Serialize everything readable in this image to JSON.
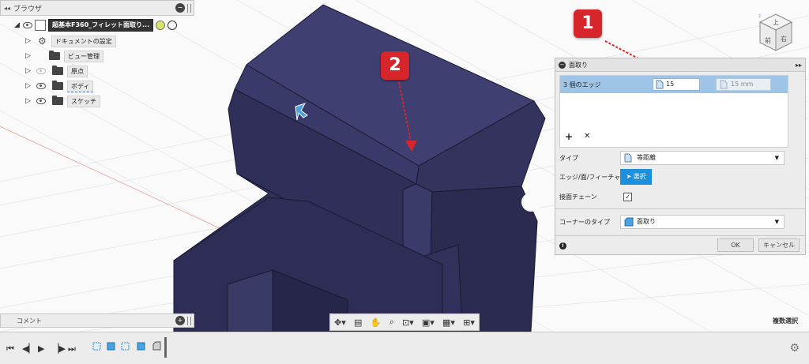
{
  "browser": {
    "title": "ブラウザ",
    "root_label": "超基本F360_フィレット面取り...",
    "items": [
      {
        "label": "ドキュメントの設定"
      },
      {
        "label": "ビュー管理"
      },
      {
        "label": "原点"
      },
      {
        "label": "ボディ"
      },
      {
        "label": "スケッチ"
      }
    ]
  },
  "comment_bar": {
    "label": "コメント"
  },
  "callouts": [
    "1",
    "2"
  ],
  "chamfer_dialog": {
    "title": "面取り",
    "selection_label": "3 個のエッジ",
    "distance_value": "15",
    "distance_placeholder": "15 mm",
    "type_label": "タイプ",
    "type_value": "等距離",
    "edge_label": "エッジ/面/フィーチャ",
    "select_button": "選択",
    "tangent_chain_label": "接面チェーン",
    "tangent_chain_checked": true,
    "corner_type_label": "コーナーのタイプ",
    "corner_type_value": "面取り",
    "ok": "OK",
    "cancel": "キャンセル",
    "add_symbol": "+",
    "remove_symbol": "✕"
  },
  "viewcube": {
    "top": "上",
    "front": "前",
    "right": "右"
  },
  "status": {
    "multi_select": "複数選択"
  },
  "colors": {
    "model": "#3d3d6e",
    "accent_red": "#d6262b",
    "selected_row": "#9ec4e8",
    "select_button": "#1d8fdb"
  }
}
